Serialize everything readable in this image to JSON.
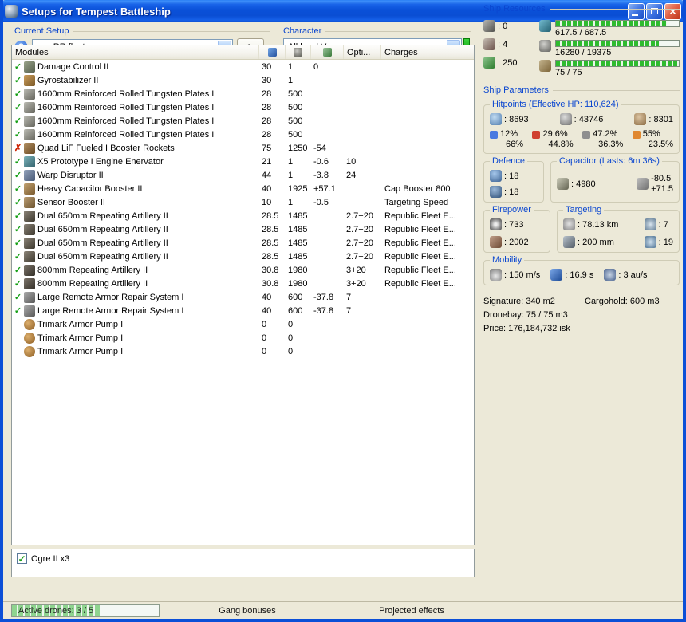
{
  "window": {
    "title": "Setups for Tempest Battleship",
    "close_glyph": "×"
  },
  "icons": {
    "help": "?"
  },
  "toolbar": {
    "current_setup_label": "Current Setup",
    "setup_value": "pvp RR fleet",
    "character_label": "Character",
    "character_value": "All level V"
  },
  "modules": {
    "col_modules": "Modules",
    "col_opti": "Opti...",
    "col_charges": "Charges",
    "rows": [
      {
        "status": "ok",
        "icon": "dcu",
        "name": "Damage Control II",
        "cpu": "30",
        "pg": "1",
        "cap": "0",
        "opti": "",
        "charge": ""
      },
      {
        "status": "ok",
        "icon": "gyro",
        "name": "Gyrostabilizer II",
        "cpu": "30",
        "pg": "1",
        "cap": "",
        "opti": "",
        "charge": ""
      },
      {
        "status": "ok",
        "icon": "plate",
        "name": "1600mm Reinforced Rolled Tungsten Plates I",
        "cpu": "28",
        "pg": "500",
        "cap": "",
        "opti": "",
        "charge": ""
      },
      {
        "status": "ok",
        "icon": "plate",
        "name": "1600mm Reinforced Rolled Tungsten Plates I",
        "cpu": "28",
        "pg": "500",
        "cap": "",
        "opti": "",
        "charge": ""
      },
      {
        "status": "ok",
        "icon": "plate",
        "name": "1600mm Reinforced Rolled Tungsten Plates I",
        "cpu": "28",
        "pg": "500",
        "cap": "",
        "opti": "",
        "charge": ""
      },
      {
        "status": "ok",
        "icon": "plate",
        "name": "1600mm Reinforced Rolled Tungsten Plates I",
        "cpu": "28",
        "pg": "500",
        "cap": "",
        "opti": "",
        "charge": ""
      },
      {
        "status": "fail",
        "icon": "mwd",
        "name": "Quad LiF Fueled I Booster Rockets",
        "cpu": "75",
        "pg": "1250",
        "cap": "-54",
        "opti": "",
        "charge": ""
      },
      {
        "status": "ok",
        "icon": "web",
        "name": "X5 Prototype I Engine Enervator",
        "cpu": "21",
        "pg": "1",
        "cap": "-0.6",
        "opti": "10",
        "charge": ""
      },
      {
        "status": "ok",
        "icon": "disruptor",
        "name": "Warp Disruptor II",
        "cpu": "44",
        "pg": "1",
        "cap": "-3.8",
        "opti": "24",
        "charge": ""
      },
      {
        "status": "ok",
        "icon": "capbooster",
        "name": "Heavy Capacitor Booster II",
        "cpu": "40",
        "pg": "1925",
        "cap": "+57.1",
        "opti": "",
        "charge": "Cap Booster 800"
      },
      {
        "status": "ok",
        "icon": "sebo",
        "name": "Sensor Booster II",
        "cpu": "10",
        "pg": "1",
        "cap": "-0.5",
        "opti": "",
        "charge": "Targeting Speed"
      },
      {
        "status": "ok",
        "icon": "gun",
        "name": "Dual 650mm Repeating Artillery II",
        "cpu": "28.5",
        "pg": "1485",
        "cap": "",
        "opti": "2.7+20",
        "charge": "Republic Fleet E..."
      },
      {
        "status": "ok",
        "icon": "gun",
        "name": "Dual 650mm Repeating Artillery II",
        "cpu": "28.5",
        "pg": "1485",
        "cap": "",
        "opti": "2.7+20",
        "charge": "Republic Fleet E..."
      },
      {
        "status": "ok",
        "icon": "gun",
        "name": "Dual 650mm Repeating Artillery II",
        "cpu": "28.5",
        "pg": "1485",
        "cap": "",
        "opti": "2.7+20",
        "charge": "Republic Fleet E..."
      },
      {
        "status": "ok",
        "icon": "gun",
        "name": "Dual 650mm Repeating Artillery II",
        "cpu": "28.5",
        "pg": "1485",
        "cap": "",
        "opti": "2.7+20",
        "charge": "Republic Fleet E..."
      },
      {
        "status": "ok",
        "icon": "gun2",
        "name": "800mm Repeating Artillery II",
        "cpu": "30.8",
        "pg": "1980",
        "cap": "",
        "opti": "3+20",
        "charge": "Republic Fleet E..."
      },
      {
        "status": "ok",
        "icon": "gun2",
        "name": "800mm Repeating Artillery II",
        "cpu": "30.8",
        "pg": "1980",
        "cap": "",
        "opti": "3+20",
        "charge": "Republic Fleet E..."
      },
      {
        "status": "ok",
        "icon": "rr",
        "name": "Large Remote Armor Repair System I",
        "cpu": "40",
        "pg": "600",
        "cap": "-37.8",
        "opti": "7",
        "charge": ""
      },
      {
        "status": "ok",
        "icon": "rr",
        "name": "Large Remote Armor Repair System I",
        "cpu": "40",
        "pg": "600",
        "cap": "-37.8",
        "opti": "7",
        "charge": ""
      },
      {
        "status": "none",
        "icon": "rig",
        "name": "Trimark Armor Pump I",
        "cpu": "0",
        "pg": "0",
        "cap": "",
        "opti": "",
        "charge": ""
      },
      {
        "status": "none",
        "icon": "rig",
        "name": "Trimark Armor Pump I",
        "cpu": "0",
        "pg": "0",
        "cap": "",
        "opti": "",
        "charge": ""
      },
      {
        "status": "none",
        "icon": "rig",
        "name": "Trimark Armor Pump I",
        "cpu": "0",
        "pg": "0",
        "cap": "",
        "opti": "",
        "charge": ""
      }
    ]
  },
  "resources": {
    "label": "Ship Resources",
    "turrets_free": "0",
    "launchers_free": "4",
    "calibration_free": "250",
    "cpu_text": "617.5 / 687.5",
    "cpu_pct": 90,
    "powergrid_text": "16280 / 19375",
    "powergrid_pct": 84,
    "bandwidth_text": "75 / 75",
    "bandwidth_pct": 100
  },
  "parameters": {
    "label": "Ship Parameters",
    "hitpoints_label": "Hitpoints (Effective HP: 110,624)",
    "shield_hp": "8693",
    "armor_hp": "43746",
    "hull_hp": "8301",
    "resists": [
      {
        "type": "em",
        "top": "12%",
        "bottom": "66%"
      },
      {
        "type": "therm",
        "top": "29.6%",
        "bottom": "44.8%"
      },
      {
        "type": "kin",
        "top": "47.2%",
        "bottom": "36.3%"
      },
      {
        "type": "exp",
        "top": "55%",
        "bottom": "23.5%"
      }
    ],
    "defence_label": "Defence",
    "defence_v1": "18",
    "defence_v2": "18",
    "capacitor_label": "Capacitor (Lasts: 6m 36s)",
    "capacitor_amount": "4980",
    "capacitor_out": "-80.5",
    "capacitor_in": "+71.5",
    "firepower_label": "Firepower",
    "firepower_dps": "733",
    "firepower_volley": "2002",
    "targeting_label": "Targeting",
    "targeting_range": "78.13 km",
    "targeting_max": "7",
    "targeting_res": "200 mm",
    "targeting_sensor": "19",
    "mobility_label": "Mobility",
    "mobility_speed": "150 m/s",
    "mobility_align": "16.9 s",
    "mobility_warp": "3 au/s",
    "signature": "Signature: 340 m2",
    "cargohold": "Cargohold: 600 m3",
    "dronebay": "Dronebay: 75 / 75 m3",
    "price": "Price: 176,184,732 isk"
  },
  "drones": {
    "items": [
      {
        "label": "Ogre II x3",
        "state": "checked"
      }
    ]
  },
  "statusbar": {
    "active_drones": "Active drones: 3 / 5",
    "drones_pct": 60,
    "gang_bonuses": "Gang bonuses",
    "projected_effects": "Projected effects"
  }
}
